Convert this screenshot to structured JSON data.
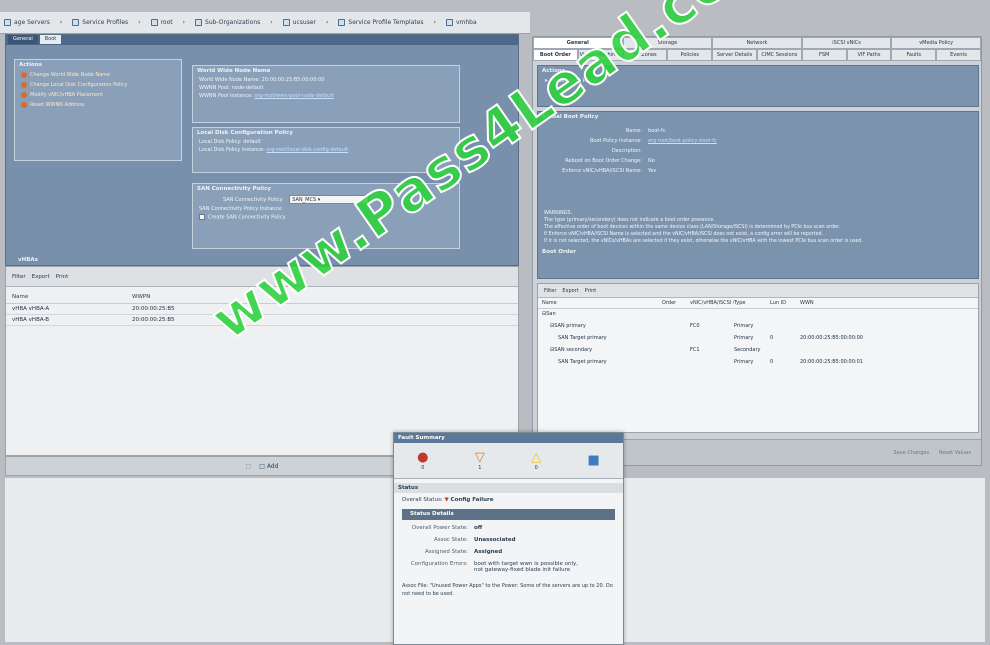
{
  "breadcrumb": [
    "age Servers",
    "Service Profiles",
    "root",
    "Sub-Organizations",
    "ucsuser",
    "Service Profile Templates",
    "vmhba"
  ],
  "left_pane": {
    "tabs": [
      "General",
      "Boot"
    ],
    "actions_title": "Actions",
    "actions": [
      "Change World Wide Node Name",
      "Change Local Disk Configuration Policy",
      "Modify vNIC/vHBA Placement",
      "Reset WWNN Address"
    ],
    "wwnn_title": "World Wide Node Name",
    "wwnn_rows": [
      {
        "k": "World Wide Node Name:",
        "v": "20:00:00:25:B5:00:00:00"
      },
      {
        "k": "WWNN Pool:",
        "v": "node-default"
      },
      {
        "k": "WWNN Pool Instance:",
        "v": "org-root/wwn-pool-node-default"
      }
    ],
    "local_disk_title": "Local Disk Configuration Policy",
    "local_disk_rows": [
      {
        "k": "Local Disk Policy:",
        "v": "default"
      },
      {
        "k": "Local Disk Policy Instance:",
        "v": "org-root/local-disk-config-default"
      }
    ],
    "san_title": "SAN Connectivity Policy",
    "san_label": "SAN Connectivity Policy:",
    "san_value": "SAN_MCS",
    "san_instance": "SAN Connectivity Policy Instance:",
    "san_create": "Create SAN Connectivity Policy",
    "vhbas_title": "vHBAs"
  },
  "left_list": {
    "toolbar": [
      "Filter",
      "Export",
      "Print"
    ],
    "columns": [
      "Name",
      "WWPN"
    ],
    "rows": [
      {
        "name": "vHBA vHBA-A",
        "wwpn": "20:00:00:25:B5"
      },
      {
        "name": "vHBA vHBA-B",
        "wwpn": "20:00:00:25:B5"
      }
    ]
  },
  "left_footer": {
    "add": "Add"
  },
  "right_pane": {
    "tabs_row1": [
      "General",
      "Storage",
      "Network",
      "iSCSI vNICs",
      "vMedia Policy"
    ],
    "tabs_row2": [
      "Boot Order",
      "Virtual Machines",
      "FC Zones",
      "Policies",
      "Server Details",
      "CIMC Sessions",
      "FSM",
      "VIF Paths",
      "Faults",
      "Events"
    ],
    "actions_title": "Actions",
    "actions": [
      "Modify Boot Policy"
    ],
    "global_title": "Global Boot Policy",
    "global_rows": [
      {
        "k": "Name:",
        "v": "boot-fc"
      },
      {
        "k": "Boot Policy Instance:",
        "v": "org-root/boot-policy-boot-fc"
      },
      {
        "k": "Description:",
        "v": ""
      },
      {
        "k": "Reboot on Boot Order Change:",
        "v": "No"
      },
      {
        "k": "Enforce vNIC/vHBA/iSCSI Name:",
        "v": "Yes"
      }
    ],
    "warnings": [
      "WARNINGS:",
      "The type (primary/secondary) does not indicate a boot order presence.",
      "The effective order of boot devices within the same device class (LAN/Storage/iSCSI) is determined by PCIe bus scan order.",
      "If Enforce vNIC/vHBA/iSCSI Name is selected and the vNIC/vHBA/iSCSI does not exist, a config error will be reported.",
      "If it is not selected, the vNICs/vHBAs are selected if they exist, otherwise the vNIC/vHBA with the lowest PCIe bus scan order is used."
    ],
    "boot_order_title": "Boot Order",
    "tree_toolbar": [
      "Filter",
      "Export",
      "Print"
    ],
    "tree_columns": [
      "Name",
      "Order",
      "vNIC/vHBA/iSCSI vNIC",
      "Type",
      "Lun ID",
      "WWN"
    ],
    "tree_rows": [
      {
        "name": "San",
        "order": "",
        "vnic": "",
        "type": "",
        "lun": "",
        "wwn": ""
      },
      {
        "name": "SAN primary",
        "order": "",
        "vnic": "FC0",
        "type": "Primary",
        "lun": "",
        "wwn": ""
      },
      {
        "name": "SAN Target primary",
        "order": "",
        "vnic": "",
        "type": "Primary",
        "lun": "0",
        "wwn": "20:00:00:25:B5:00:00:00"
      },
      {
        "name": "SAN secondary",
        "order": "",
        "vnic": "FC1",
        "type": "Secondary",
        "lun": "",
        "wwn": ""
      },
      {
        "name": "SAN Target primary",
        "order": "",
        "vnic": "",
        "type": "Primary",
        "lun": "0",
        "wwn": "20:00:00:25:B5:00:00:01"
      }
    ],
    "footer": [
      "Save Changes",
      "Reset Values"
    ]
  },
  "fault_summary": {
    "title": "Fault Summary",
    "counts": [
      {
        "icon": "critical-icon",
        "count": "0"
      },
      {
        "icon": "major-icon",
        "count": "1"
      },
      {
        "icon": "minor-icon",
        "count": "0"
      },
      {
        "icon": "info-icon",
        "count": ""
      }
    ],
    "status_title": "Status",
    "overall_label": "Overall Status:",
    "overall_value": "Config Failure",
    "details_title": "Status Details",
    "details": [
      {
        "k": "Overall Power State:",
        "v": "off"
      },
      {
        "k": "Assoc State:",
        "v": "Unassociated"
      },
      {
        "k": "Assigned State:",
        "v": "Assigned"
      },
      {
        "k": "Configuration Errors:",
        "v": "boot with target wwn is possible only, not gateway-fixed blade init failure"
      }
    ],
    "description": "Assoc File: \"Unused Power Apps\" to the Power: Some of the servers are up to 20. Do not need to be used."
  },
  "watermark": "www.Pass4Lead.com"
}
